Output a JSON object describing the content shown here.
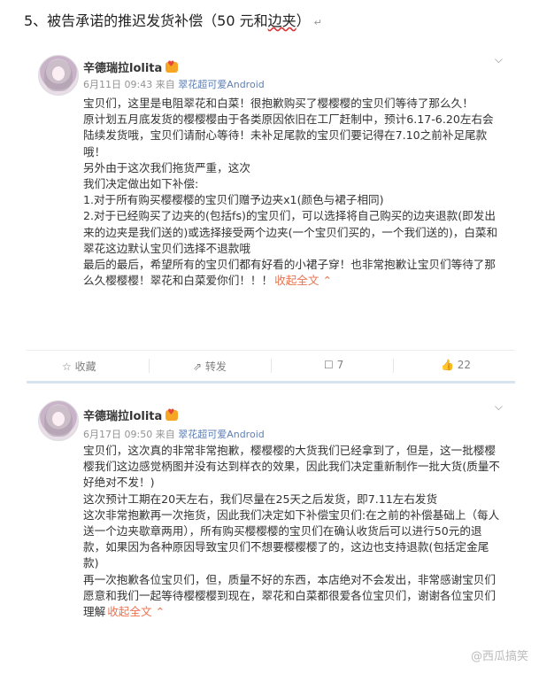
{
  "heading": {
    "prefix": "5、被告承诺的推迟发货补偿（50 元和",
    "squiggle": "边夹",
    "suffix": "）",
    "ret": "↵"
  },
  "posts": [
    {
      "user": "辛德瑞拉lolita",
      "date": "6月11日 09:43",
      "from": "来自",
      "source": "翠花超可爱Android",
      "paragraphs": [
        "宝贝们，这里是电阻翠花和白菜！很抱歉购买了樱樱樱的宝贝们等待了那么久！",
        "原计划五月底发货的樱樱樱由于各类原因依旧在工厂赶制中，预计6.17-6.20左右会陆续发货哦，宝贝们请耐心等待！未补足尾款的宝贝们要记得在7.10之前补足尾款哦！",
        "另外由于这次我们拖货严重，这次",
        "我们决定做出如下补偿:",
        "1.对于所有购买樱樱樱的宝贝们赠予边夹x1(颜色与裙子相同)",
        "2.对于已经购买了边夹的(包括fs)的宝贝们，可以选择将自己购买的边夹退款(即发出来的边夹是我们送的)或选择接受两个边夹(一个宝贝们买的，一个我们送的)，白菜和翠花这边默认宝贝们选择不退款哦",
        "最后的最后，希望所有的宝贝们都有好看的小裙子穿！也非常抱歉让宝贝们等待了那么久樱樱樱！翠花和白菜爱你们！！！"
      ],
      "collapse": "收起全文 ⌃",
      "actions": {
        "fav": "收藏",
        "share": "转发",
        "comment": "7",
        "like": "22"
      }
    },
    {
      "user": "辛德瑞拉lolita",
      "date": "6月17日 09:50",
      "from": "来自",
      "source": "翠花超可爱Android",
      "paragraphs": [
        "宝贝们，这次真的非常非常抱歉，樱樱樱的大货我们已经拿到了，但是，这一批樱樱樱我们这边感觉柄图并没有达到样衣的效果，因此我们决定重新制作一批大货(质量不好绝对不发！)",
        "这次预计工期在20天左右，我们尽量在25天之后发货，即7.11左右发货",
        "这次非常抱歉再一次拖货，因此我们决定如下补偿宝贝们:在之前的补偿基础上（每人送一个边夹歇章两用），所有购买樱樱樱的宝贝们在确认收货后可以进行50元的退款，如果因为各种原因导致宝贝们不想要樱樱樱了的，这边也支持退款(包括定金尾款)",
        "再一次抱歉各位宝贝们，但，质量不好的东西，本店绝对不会发出，非常感谢宝贝们愿意和我们一起等待樱樱樱到现在，翠花和白菜都很爱各位宝贝们，谢谢各位宝贝们理解"
      ],
      "collapse": "收起全文 ⌃"
    }
  ],
  "watermark": "@西瓜搞笑"
}
